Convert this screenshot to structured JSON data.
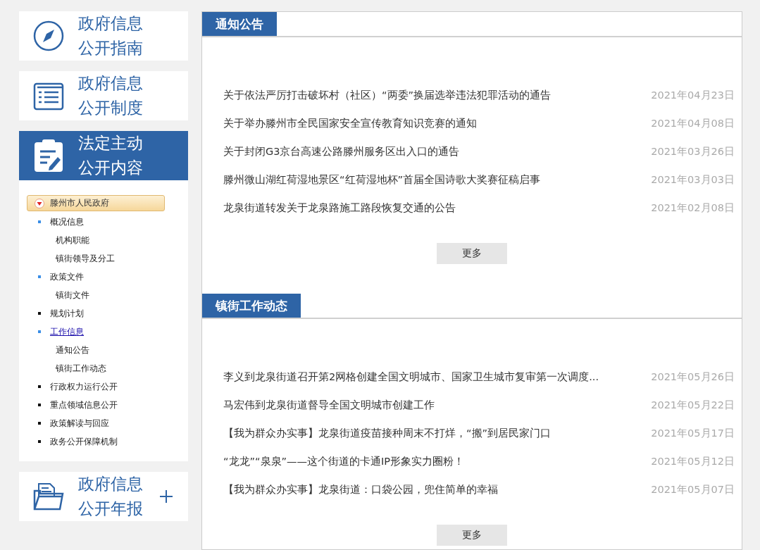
{
  "nav_cards": [
    {
      "kind": "compass",
      "lines": [
        "政府信息",
        "公开指南"
      ],
      "selected": false
    },
    {
      "kind": "list",
      "lines": [
        "政府信息",
        "公开制度"
      ],
      "selected": false
    },
    {
      "kind": "clipboard",
      "lines": [
        "法定主动",
        "公开内容"
      ],
      "selected": true
    }
  ],
  "tree": {
    "root": {
      "label": "滕州市人民政府",
      "expanded": true
    },
    "items": [
      {
        "label": "概况信息",
        "selected": false,
        "children": [
          {
            "label": "机构职能"
          },
          {
            "label": "镇街领导及分工"
          }
        ]
      },
      {
        "label": "政策文件",
        "selected": false,
        "children": [
          {
            "label": "镇街文件"
          }
        ]
      },
      {
        "label": "规划计划",
        "selected": false
      },
      {
        "label": "工作信息",
        "selected": true,
        "children": [
          {
            "label": "通知公告"
          },
          {
            "label": "镇街工作动态"
          }
        ]
      },
      {
        "label": "行政权力运行公开",
        "selected": false
      },
      {
        "label": "重点领域信息公开",
        "selected": false
      },
      {
        "label": "政策解读与回应",
        "selected": false
      },
      {
        "label": "政务公开保障机制",
        "selected": false
      }
    ]
  },
  "bottom_card": {
    "kind": "folder",
    "lines": [
      "政府信息",
      "公开年报"
    ],
    "selected": false
  },
  "sections": [
    {
      "title": "通知公告",
      "more": "更多",
      "items": [
        {
          "title": "关于依法严厉打击破坏村（社区）“两委”换届选举违法犯罪活动的通告",
          "date": "2021年04月23日"
        },
        {
          "title": "关于举办滕州市全民国家安全宣传教育知识竞赛的通知",
          "date": "2021年04月08日"
        },
        {
          "title": "关于封闭G3京台高速公路滕州服务区出入口的通告",
          "date": "2021年03月26日"
        },
        {
          "title": "滕州微山湖红荷湿地景区“红荷湿地杯”首届全国诗歌大奖赛征稿启事",
          "date": "2021年03月03日"
        },
        {
          "title": "龙泉街道转发关于龙泉路施工路段恢复交通的公告",
          "date": "2021年02月08日"
        }
      ]
    },
    {
      "title": "镇街工作动态",
      "more": "更多",
      "items": [
        {
          "title": "李义到龙泉街道召开第2网格创建全国文明城市、国家卫生城市复审第一次调度...",
          "date": "2021年05月26日"
        },
        {
          "title": "马宏伟到龙泉街道督导全国文明城市创建工作",
          "date": "2021年05月22日"
        },
        {
          "title": "【我为群众办实事】龙泉街道疫苗接种周末不打烊，“搬”到居民家门口",
          "date": "2021年05月17日"
        },
        {
          "title": "“龙龙”“泉泉”——这个街道的卡通IP形象实力圈粉！",
          "date": "2021年05月12日"
        },
        {
          "title": "【我为群众办实事】龙泉街道：口袋公园，兜住简单的幸福",
          "date": "2021年05月07日"
        }
      ]
    }
  ]
}
